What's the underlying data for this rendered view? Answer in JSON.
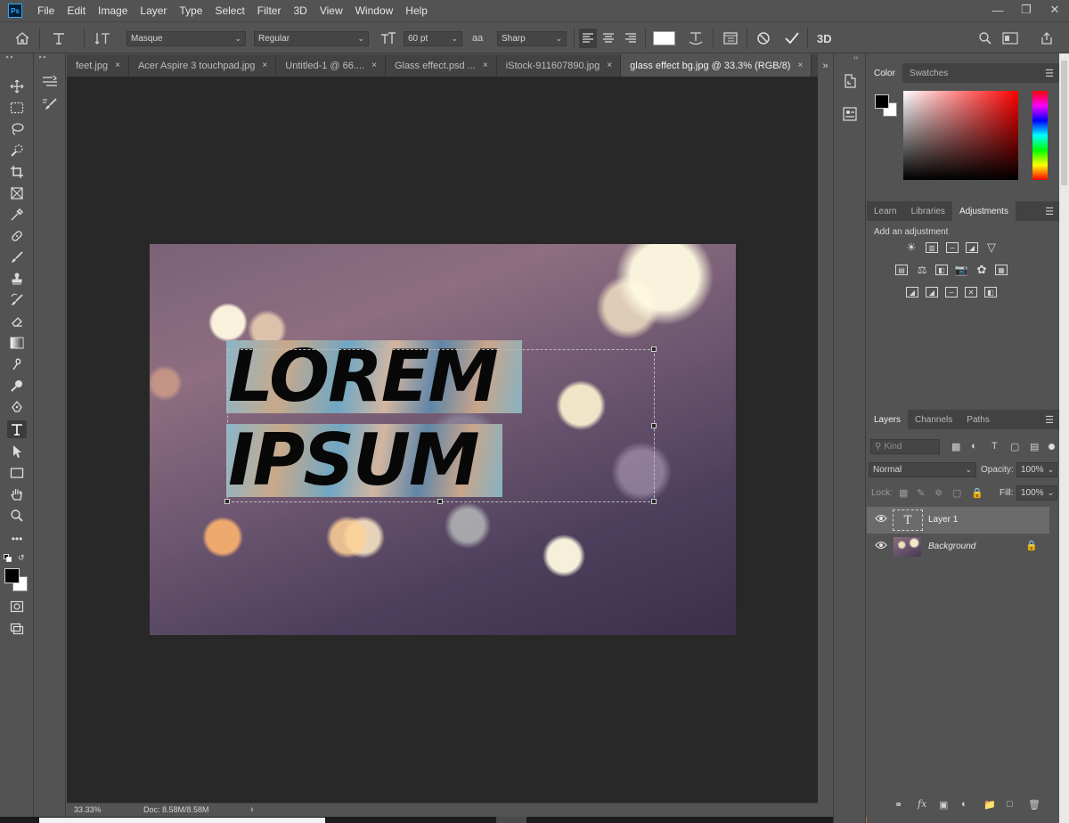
{
  "app": {
    "logo_text": "Ps"
  },
  "menu": [
    "File",
    "Edit",
    "Image",
    "Layer",
    "Type",
    "Select",
    "Filter",
    "3D",
    "View",
    "Window",
    "Help"
  ],
  "window_controls": {
    "minimize": "—",
    "restore": "❐",
    "close": "✕"
  },
  "options": {
    "font_family": "Masque",
    "font_style": "Regular",
    "font_size": "60 pt",
    "aa_label": "aa",
    "anti_alias": "Sharp",
    "label_3d": "3D"
  },
  "tabs": [
    {
      "label": "feet.jpg",
      "active": false
    },
    {
      "label": "Acer Aspire 3 touchpad.jpg",
      "active": false
    },
    {
      "label": "Untitled-1 @ 66....",
      "active": false
    },
    {
      "label": "Glass effect.psd ...",
      "active": false
    },
    {
      "label": "iStock-911607890.jpg",
      "active": false
    },
    {
      "label": "glass effect bg.jpg @ 33.3% (RGB/8)",
      "active": true
    }
  ],
  "tabs_more": "»",
  "tab_close": "×",
  "canvas": {
    "line1": "LOREM",
    "line2": "IPSUM"
  },
  "status": {
    "zoom": "33.33%",
    "doc": "Doc: 8.58M/8.58M",
    "arrow": "›"
  },
  "color_panel": {
    "tabs": [
      "Color",
      "Swatches"
    ],
    "active": "Color"
  },
  "adjust_panel": {
    "tabs": [
      "Learn",
      "Libraries",
      "Adjustments"
    ],
    "active": "Adjustments",
    "hint": "Add an adjustment"
  },
  "layers_panel": {
    "tabs": [
      "Layers",
      "Channels",
      "Paths"
    ],
    "active": "Layers",
    "filter_placeholder": "Kind",
    "blend_mode": "Normal",
    "opacity_label": "Opacity:",
    "opacity": "100%",
    "lock_label": "Lock:",
    "fill_label": "Fill:",
    "fill": "100%",
    "layers": [
      {
        "name": "Layer 1",
        "selected": true,
        "type": "text",
        "thumb_text": "T"
      },
      {
        "name": "Background",
        "selected": false,
        "type": "image",
        "locked": true
      }
    ],
    "footer_fx": "fx"
  },
  "colors": {
    "foreground": "#000000",
    "background": "#ffffff",
    "accent": "#31a8ff"
  }
}
